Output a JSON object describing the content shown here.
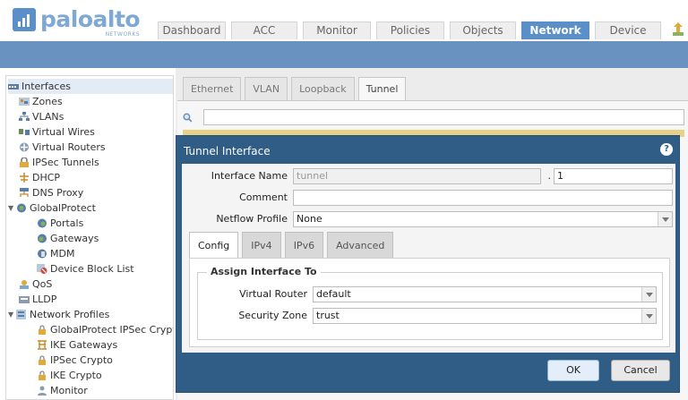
{
  "header": {
    "logo_text": "paloalto",
    "logo_sub": "NETWORKS",
    "tabs": [
      {
        "label": "Dashboard",
        "active": false
      },
      {
        "label": "ACC",
        "active": false
      },
      {
        "label": "Monitor",
        "active": false
      },
      {
        "label": "Policies",
        "active": false
      },
      {
        "label": "Objects",
        "active": false
      },
      {
        "label": "Network",
        "active": true
      },
      {
        "label": "Device",
        "active": false
      }
    ],
    "commit_icon": "commit-icon"
  },
  "sidebar": {
    "items": [
      {
        "label": "Interfaces",
        "icon": "interfaces-icon",
        "selected": true
      },
      {
        "label": "Zones",
        "icon": "zones-icon"
      },
      {
        "label": "VLANs",
        "icon": "vlans-icon"
      },
      {
        "label": "Virtual Wires",
        "icon": "virtual-wires-icon"
      },
      {
        "label": "Virtual Routers",
        "icon": "virtual-routers-icon"
      },
      {
        "label": "IPSec Tunnels",
        "icon": "ipsec-tunnels-icon"
      },
      {
        "label": "DHCP",
        "icon": "dhcp-icon"
      },
      {
        "label": "DNS Proxy",
        "icon": "dns-proxy-icon"
      },
      {
        "label": "GlobalProtect",
        "icon": "globalprotect-icon",
        "expanded": true
      },
      {
        "label": "Portals",
        "icon": "portals-icon"
      },
      {
        "label": "Gateways",
        "icon": "gateways-icon"
      },
      {
        "label": "MDM",
        "icon": "mdm-icon"
      },
      {
        "label": "Device Block List",
        "icon": "device-block-list-icon"
      },
      {
        "label": "QoS",
        "icon": "qos-icon"
      },
      {
        "label": "LLDP",
        "icon": "lldp-icon"
      },
      {
        "label": "Network Profiles",
        "icon": "network-profiles-icon",
        "expanded": true
      },
      {
        "label": "GlobalProtect IPSec Crypt",
        "icon": "lock-icon"
      },
      {
        "label": "IKE Gateways",
        "icon": "ike-gateways-icon"
      },
      {
        "label": "IPSec Crypto",
        "icon": "lock-icon"
      },
      {
        "label": "IKE Crypto",
        "icon": "lock-icon"
      },
      {
        "label": "Monitor",
        "icon": "monitor-icon"
      }
    ]
  },
  "main": {
    "tabs": [
      {
        "label": "Ethernet",
        "active": false
      },
      {
        "label": "VLAN",
        "active": false
      },
      {
        "label": "Loopback",
        "active": false
      },
      {
        "label": "Tunnel",
        "active": true
      }
    ]
  },
  "dialog": {
    "title": "Tunnel Interface",
    "help_icon": "?",
    "interface_name_label": "Interface Name",
    "interface_name_value": "tunnel",
    "interface_dot": ".",
    "interface_suffix": "1",
    "comment_label": "Comment",
    "comment_value": "",
    "netflow_label": "Netflow Profile",
    "netflow_value": "None",
    "tabs": [
      {
        "label": "Config",
        "active": true
      },
      {
        "label": "IPv4",
        "active": false
      },
      {
        "label": "IPv6",
        "active": false
      },
      {
        "label": "Advanced",
        "active": false
      }
    ],
    "section_title": "Assign Interface To",
    "virtual_router_label": "Virtual Router",
    "virtual_router_value": "default",
    "security_zone_label": "Security Zone",
    "security_zone_value": "trust",
    "ok_label": "OK",
    "cancel_label": "Cancel"
  }
}
